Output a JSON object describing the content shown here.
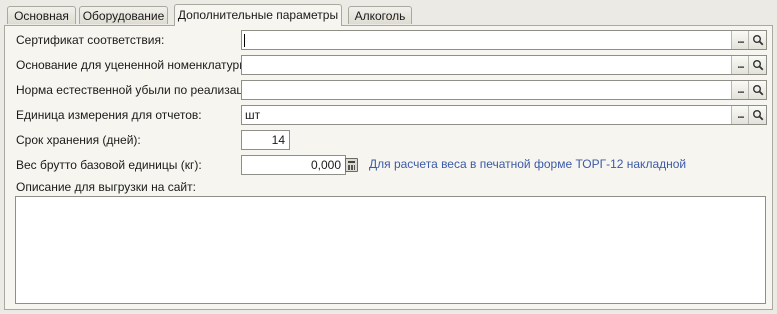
{
  "tabs": [
    {
      "label": "Основная"
    },
    {
      "label": "Оборудование"
    },
    {
      "label": "Дополнительные параметры"
    },
    {
      "label": "Алкоголь"
    }
  ],
  "active_tab": "Дополнительные параметры",
  "form": {
    "certificate_label": "Сертификат соответствия:",
    "certificate_value": "",
    "discount_basis_label": "Основание для уцененной номенклатуры:",
    "discount_basis_value": "",
    "loss_norm_label": "Норма естественной убыли по реализации:",
    "loss_norm_value": "",
    "report_unit_label": "Единица измерения для отчетов:",
    "report_unit_value": "шт",
    "shelf_life_label": "Срок хранения (дней):",
    "shelf_life_value": "14",
    "gross_weight_label": "Вес брутто базовой единицы (кг):",
    "gross_weight_value": "0,000",
    "weight_hint": "Для расчета веса в печатной форме ТОРГ-12 накладной",
    "description_label": "Описание для выгрузки на сайт:",
    "description_value": ""
  },
  "icons": {
    "select": "ellipsis-button",
    "open": "magnifier-icon",
    "calculator": "calculator-icon"
  }
}
